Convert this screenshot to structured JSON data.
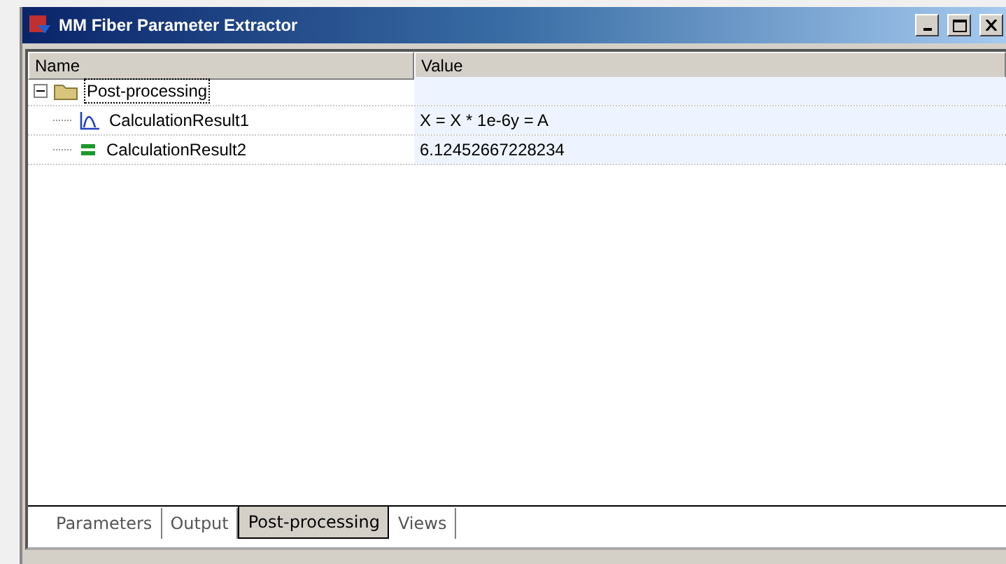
{
  "window": {
    "title": "MM Fiber Parameter Extractor"
  },
  "table": {
    "columns": [
      "Name",
      "Value"
    ],
    "rows": [
      {
        "name": "Post-processing",
        "value": "",
        "kind": "folder",
        "expanded": true,
        "children": [
          {
            "name": "CalculationResult1",
            "value": "X = X * 1e-6y = A",
            "kind": "curve"
          },
          {
            "name": "CalculationResult2",
            "value": "6.12452667228234",
            "kind": "stack"
          }
        ]
      }
    ]
  },
  "tabs": [
    {
      "label": "Parameters",
      "selected": false
    },
    {
      "label": "Output",
      "selected": false
    },
    {
      "label": "Post-processing",
      "selected": true
    },
    {
      "label": "Views",
      "selected": false
    }
  ]
}
